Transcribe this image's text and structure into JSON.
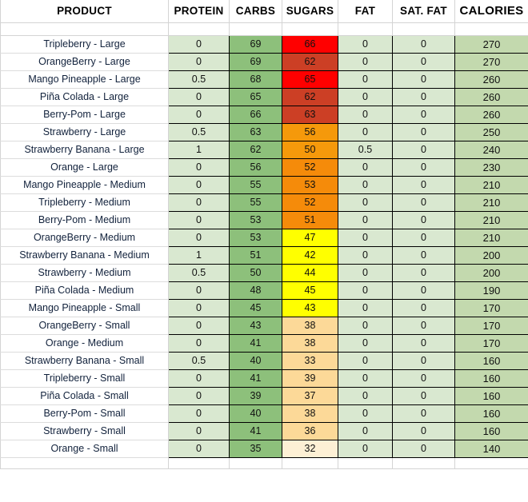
{
  "table": {
    "columns": [
      {
        "key": "product",
        "label": "PRODUCT"
      },
      {
        "key": "protein",
        "label": "PROTEIN"
      },
      {
        "key": "carbs",
        "label": "CARBS"
      },
      {
        "key": "sugars",
        "label": "SUGARS"
      },
      {
        "key": "fat",
        "label": "FAT"
      },
      {
        "key": "satfat",
        "label": "SAT. FAT"
      },
      {
        "key": "calories",
        "label": "CALORIES"
      }
    ],
    "rows": [
      {
        "product": "Tripleberry - Large",
        "protein": "0",
        "carbs": "69",
        "sugars": "66",
        "fat": "0",
        "satfat": "0",
        "calories": "270"
      },
      {
        "product": "OrangeBerry - Large",
        "protein": "0",
        "carbs": "69",
        "sugars": "62",
        "fat": "0",
        "satfat": "0",
        "calories": "270"
      },
      {
        "product": "Mango Pineapple - Large",
        "protein": "0.5",
        "carbs": "68",
        "sugars": "65",
        "fat": "0",
        "satfat": "0",
        "calories": "260"
      },
      {
        "product": "Piña Colada - Large",
        "protein": "0",
        "carbs": "65",
        "sugars": "62",
        "fat": "0",
        "satfat": "0",
        "calories": "260"
      },
      {
        "product": "Berry-Pom - Large",
        "protein": "0",
        "carbs": "66",
        "sugars": "63",
        "fat": "0",
        "satfat": "0",
        "calories": "260"
      },
      {
        "product": "Strawberry - Large",
        "protein": "0.5",
        "carbs": "63",
        "sugars": "56",
        "fat": "0",
        "satfat": "0",
        "calories": "250"
      },
      {
        "product": "Strawberry Banana - Large",
        "protein": "1",
        "carbs": "62",
        "sugars": "50",
        "fat": "0.5",
        "satfat": "0",
        "calories": "240"
      },
      {
        "product": "Orange - Large",
        "protein": "0",
        "carbs": "56",
        "sugars": "52",
        "fat": "0",
        "satfat": "0",
        "calories": "230"
      },
      {
        "product": "Mango Pineapple - Medium",
        "protein": "0",
        "carbs": "55",
        "sugars": "53",
        "fat": "0",
        "satfat": "0",
        "calories": "210"
      },
      {
        "product": "Tripleberry - Medium",
        "protein": "0",
        "carbs": "55",
        "sugars": "52",
        "fat": "0",
        "satfat": "0",
        "calories": "210"
      },
      {
        "product": "Berry-Pom - Medium",
        "protein": "0",
        "carbs": "53",
        "sugars": "51",
        "fat": "0",
        "satfat": "0",
        "calories": "210"
      },
      {
        "product": "OrangeBerry - Medium",
        "protein": "0",
        "carbs": "53",
        "sugars": "47",
        "fat": "0",
        "satfat": "0",
        "calories": "210"
      },
      {
        "product": "Strawberry Banana - Medium",
        "protein": "1",
        "carbs": "51",
        "sugars": "42",
        "fat": "0",
        "satfat": "0",
        "calories": "200"
      },
      {
        "product": "Strawberry - Medium",
        "protein": "0.5",
        "carbs": "50",
        "sugars": "44",
        "fat": "0",
        "satfat": "0",
        "calories": "200"
      },
      {
        "product": "Piña Colada - Medium",
        "protein": "0",
        "carbs": "48",
        "sugars": "45",
        "fat": "0",
        "satfat": "0",
        "calories": "190"
      },
      {
        "product": "Mango Pineapple - Small",
        "protein": "0",
        "carbs": "45",
        "sugars": "43",
        "fat": "0",
        "satfat": "0",
        "calories": "170"
      },
      {
        "product": "OrangeBerry - Small",
        "protein": "0",
        "carbs": "43",
        "sugars": "38",
        "fat": "0",
        "satfat": "0",
        "calories": "170"
      },
      {
        "product": "Orange - Medium",
        "protein": "0",
        "carbs": "41",
        "sugars": "38",
        "fat": "0",
        "satfat": "0",
        "calories": "170"
      },
      {
        "product": "Strawberry Banana - Small",
        "protein": "0.5",
        "carbs": "40",
        "sugars": "33",
        "fat": "0",
        "satfat": "0",
        "calories": "160"
      },
      {
        "product": "Tripleberry - Small",
        "protein": "0",
        "carbs": "41",
        "sugars": "39",
        "fat": "0",
        "satfat": "0",
        "calories": "160"
      },
      {
        "product": "Piña Colada - Small",
        "protein": "0",
        "carbs": "39",
        "sugars": "37",
        "fat": "0",
        "satfat": "0",
        "calories": "160"
      },
      {
        "product": "Berry-Pom - Small",
        "protein": "0",
        "carbs": "40",
        "sugars": "38",
        "fat": "0",
        "satfat": "0",
        "calories": "160"
      },
      {
        "product": "Strawberry - Small",
        "protein": "0",
        "carbs": "41",
        "sugars": "36",
        "fat": "0",
        "satfat": "0",
        "calories": "160"
      },
      {
        "product": "Orange - Small",
        "protein": "0",
        "carbs": "35",
        "sugars": "32",
        "fat": "0",
        "satfat": "0",
        "calories": "140"
      }
    ],
    "cell_colors": {
      "protein": "#d9e8d0",
      "fat": "#d9e8d0",
      "satfat": "#d9e8d0",
      "carbs": "#8dc07b",
      "calories": "#c3d9ae",
      "sugars": {
        "66": "#ff0000",
        "65": "#ff0000",
        "63": "#cc3f25",
        "62": "#cc3f25",
        "56": "#f5990b",
        "53": "#f58b0a",
        "52": "#f58b0a",
        "51": "#f58b0a",
        "50": "#f5990b",
        "47": "#ffff00",
        "45": "#ffff00",
        "44": "#ffff00",
        "43": "#ffff00",
        "42": "#ffff00",
        "39": "#fcd998",
        "38": "#fcd998",
        "37": "#fcd998",
        "36": "#fcd998",
        "33": "#fcd998",
        "32": "#fdf0d5"
      }
    }
  }
}
